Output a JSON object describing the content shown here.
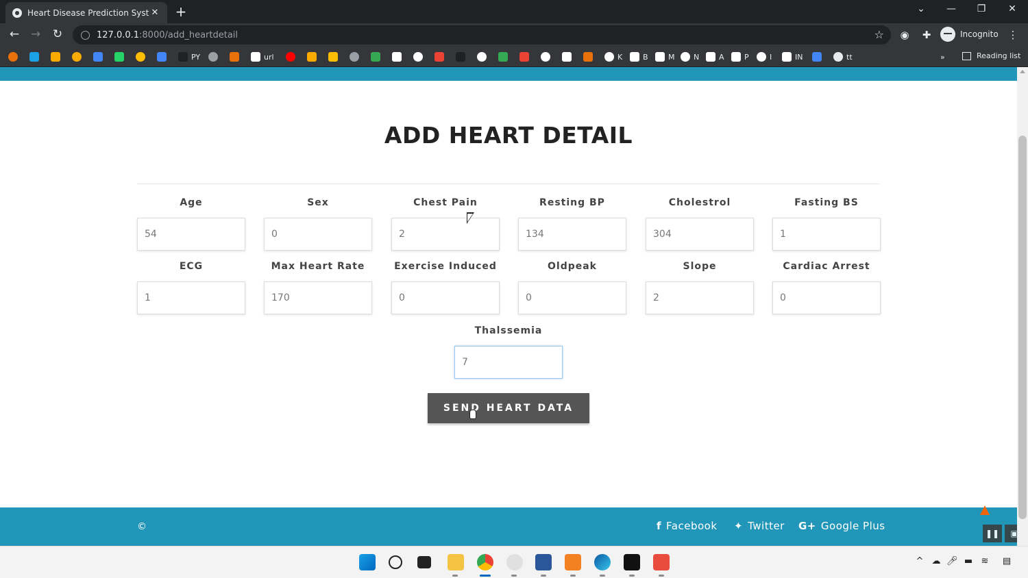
{
  "browser": {
    "tab_title": "Heart Disease Prediction System",
    "tab_close": "✕",
    "new_tab": "+",
    "url_host": "127.0.0.1",
    "url_path": ":8000/add_heartdetail",
    "profile_label": "Incognito",
    "reading_list": "Reading list",
    "more_bookmarks": "»",
    "bookmarks": [
      {
        "label": "",
        "color": "#e8710a"
      },
      {
        "label": "",
        "color": "#1aa1e6"
      },
      {
        "label": "",
        "color": "#f9ab00"
      },
      {
        "label": "",
        "color": "#f9ab00"
      },
      {
        "label": "",
        "color": "#4285f4"
      },
      {
        "label": "",
        "color": "#25d366"
      },
      {
        "label": "",
        "color": "#fbbc04"
      },
      {
        "label": "",
        "color": "#4285f4"
      },
      {
        "label": "PY",
        "color": "#202124"
      },
      {
        "label": "",
        "color": "#9aa0a6"
      },
      {
        "label": "",
        "color": "#e8710a"
      },
      {
        "label": "url",
        "color": "#ffffff"
      },
      {
        "label": "",
        "color": "#ff0000"
      },
      {
        "label": "",
        "color": "#f9ab00"
      },
      {
        "label": "",
        "color": "#fbbc04"
      },
      {
        "label": "",
        "color": "#9aa0a6"
      },
      {
        "label": "",
        "color": "#34a853"
      },
      {
        "label": "",
        "color": "#ffffff"
      },
      {
        "label": "",
        "color": "#ffffff"
      },
      {
        "label": "",
        "color": "#ea4335"
      },
      {
        "label": "",
        "color": "#202124"
      },
      {
        "label": "",
        "color": "#ffffff"
      },
      {
        "label": "",
        "color": "#34a853"
      },
      {
        "label": "",
        "color": "#ea4335"
      },
      {
        "label": "",
        "color": "#ffffff"
      },
      {
        "label": "",
        "color": "#ffffff"
      },
      {
        "label": "",
        "color": "#e8710a"
      },
      {
        "label": "K",
        "color": "#ffffff"
      },
      {
        "label": "B",
        "color": "#ffffff"
      },
      {
        "label": "M",
        "color": "#ffffff"
      },
      {
        "label": "N",
        "color": "#ffffff"
      },
      {
        "label": "A",
        "color": "#ffffff"
      },
      {
        "label": "P",
        "color": "#ffffff"
      },
      {
        "label": "I",
        "color": "#ffffff"
      },
      {
        "label": "IN",
        "color": "#ffffff"
      },
      {
        "label": "",
        "color": "#4285f4"
      },
      {
        "label": "tt",
        "color": "#e8eaed"
      }
    ]
  },
  "page": {
    "title": "ADD HEART DETAIL",
    "fields": [
      {
        "label": "Age",
        "value": "54"
      },
      {
        "label": "Sex",
        "value": "0"
      },
      {
        "label": "Chest Pain",
        "value": "2"
      },
      {
        "label": "Resting BP",
        "value": "134"
      },
      {
        "label": "Cholestrol",
        "value": "304"
      },
      {
        "label": "Fasting BS",
        "value": "1"
      },
      {
        "label": "ECG",
        "value": "1"
      },
      {
        "label": "Max Heart Rate",
        "value": "170"
      },
      {
        "label": "Exercise Induced",
        "value": "0"
      },
      {
        "label": "Oldpeak",
        "value": "0"
      },
      {
        "label": "Slope",
        "value": "2"
      },
      {
        "label": "Cardiac Arrest",
        "value": "0"
      },
      {
        "label": "Thalssemia",
        "value": "7"
      }
    ],
    "submit_label": "SEND HEART DATA"
  },
  "footer": {
    "copyright": "©",
    "facebook": "Facebook",
    "twitter": "Twitter",
    "google_plus": "Google Plus"
  },
  "colors": {
    "accent": "#2196b8",
    "button": "#555555"
  }
}
